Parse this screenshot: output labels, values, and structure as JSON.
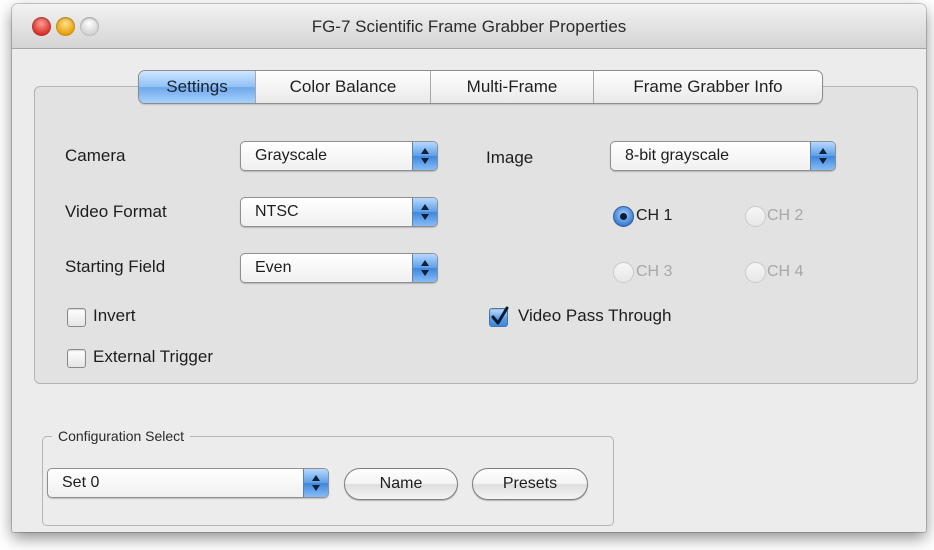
{
  "window": {
    "title": "FG-7 Scientific Frame Grabber Properties"
  },
  "tabs": [
    {
      "label": "Settings",
      "active": true
    },
    {
      "label": "Color Balance",
      "active": false
    },
    {
      "label": "Multi-Frame",
      "active": false
    },
    {
      "label": "Frame Grabber Info",
      "active": false
    }
  ],
  "settings": {
    "camera": {
      "label": "Camera",
      "value": "Grayscale"
    },
    "video_format": {
      "label": "Video Format",
      "value": "NTSC"
    },
    "starting_field": {
      "label": "Starting Field",
      "value": "Even"
    },
    "image": {
      "label": "Image",
      "value": "8-bit grayscale"
    },
    "channels": [
      {
        "label": "CH 1",
        "selected": true,
        "enabled": true
      },
      {
        "label": "CH 2",
        "selected": false,
        "enabled": false
      },
      {
        "label": "CH 3",
        "selected": false,
        "enabled": false
      },
      {
        "label": "CH 4",
        "selected": false,
        "enabled": false
      }
    ],
    "invert": {
      "label": "Invert",
      "checked": false
    },
    "external_trigger": {
      "label": "External Trigger",
      "checked": false
    },
    "video_pass_through": {
      "label": "Video Pass Through",
      "checked": true
    }
  },
  "configuration": {
    "title": "Configuration Select",
    "set_value": "Set 0",
    "name_button": "Name",
    "presets_button": "Presets"
  },
  "icons": {
    "popup_arrows": "up-down-arrows-icon",
    "checkmark": "checkmark-icon"
  },
  "colors": {
    "accent_blue": "#5d9ee6",
    "window_bg": "#ececec",
    "pane_bg": "#e2e2e2",
    "disabled_text": "#a8a8a8"
  }
}
